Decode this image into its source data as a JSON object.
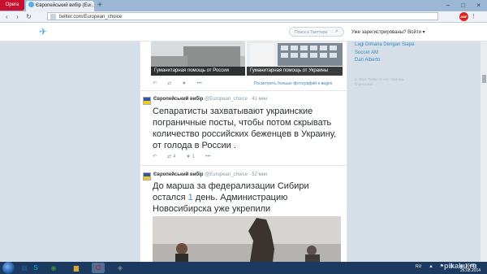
{
  "browser": {
    "opera_label": "Opera",
    "tab_title": "Європейський вибір (Eu...",
    "tab_close": "×",
    "new_tab": "+",
    "window_controls": "– □ ×",
    "nav_back": "‹",
    "nav_forward": "›",
    "nav_reload": "↻",
    "url": "twitter.com/European_choice",
    "adblock_label": "ABP",
    "ext_icon": "⋮"
  },
  "twitter_header": {
    "bird_glyph": "✈",
    "search_placeholder": "Поиск в Твиттере",
    "search_icon_glyph": "⌕",
    "register_prompt": "Уже зарегистрированы? Войти ▾"
  },
  "photo_row": {
    "photos": [
      {
        "caption": "Гуманитарная помощь от России"
      },
      {
        "caption": "Гуманитарная помощь от Украины"
      }
    ],
    "actions": [
      "↶",
      "⇄",
      "★",
      "•••"
    ],
    "more_link": "Посмотреть больше фотографий и видео"
  },
  "tweets": [
    {
      "name": "Європейський вибір",
      "handle": "@European_choice",
      "time": "· 41 мин",
      "text": "Сепаратисты захватывают украинские пограничные посты, чтобы потом скрывать количество российских беженцев в Украину, от голода в России .",
      "actions": [
        "↶",
        "⇄",
        "4",
        "★",
        "1",
        "•••"
      ]
    },
    {
      "name": "Європейський вибір",
      "handle": "@European_choice",
      "time": "· 52 мин",
      "text_before": "До марша за федерализации Сибири остался ",
      "text_highlight": "1",
      "text_after": " день. Администрацию Новосибирска уже укрепили"
    }
  ],
  "sidebar": {
    "links": [
      "Lagi Dimana Dengan Siapa",
      "Soccer AM",
      "Dan Alberto"
    ],
    "footer_line1": "© 2014 Twitter   О нас   Помощь",
    "footer_line2": "О рекламе"
  },
  "taskbar": {
    "apps": [
      {
        "name": "explorer",
        "glyph": "▤",
        "color": "#2b5f9e"
      },
      {
        "name": "skype",
        "glyph": "S",
        "color": "#00aff0"
      },
      {
        "name": "chrome",
        "glyph": "◉",
        "color": "#3a8f3a"
      },
      {
        "name": "folder",
        "glyph": "▆",
        "color": "#d9a53a"
      },
      {
        "name": "opera",
        "glyph": "O",
        "color": "#c8102e"
      },
      {
        "name": "app6",
        "glyph": "◈",
        "color": "#7a8796"
      }
    ],
    "lang": "RU",
    "tray": "▲ ⚑ ▮ ◀)",
    "time": "16:08",
    "date": "26.08.2014"
  },
  "watermark": "pikabu.ru"
}
